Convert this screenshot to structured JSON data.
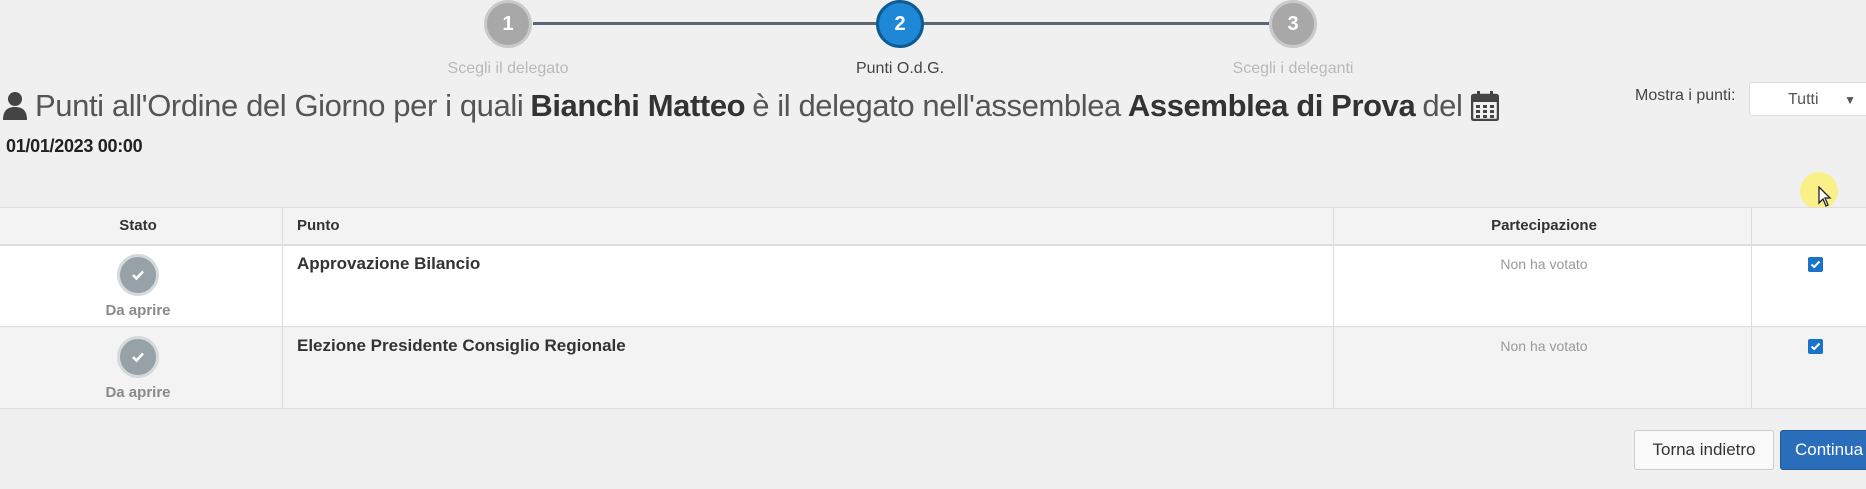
{
  "stepper": {
    "steps": [
      {
        "number": "1",
        "label": "Scegli il delegato"
      },
      {
        "number": "2",
        "label": "Punti O.d.G."
      },
      {
        "number": "3",
        "label": "Scegli i deleganti"
      }
    ],
    "active_step": 2
  },
  "header": {
    "prefix": "Punti all'Ordine del Giorno per i quali",
    "delegate_name": "Bianchi Matteo",
    "middle": "è il delegato nell'assemblea",
    "assembly_name": "Assemblea di Prova",
    "suffix": "del",
    "datetime": "01/01/2023 00:00"
  },
  "filter": {
    "label": "Mostra i punti:",
    "selected": "Tutti"
  },
  "table": {
    "columns": [
      "Stato",
      "Punto",
      "Partecipazione",
      ""
    ],
    "rows": [
      {
        "stato": "Da aprire",
        "punto": "Approvazione Bilancio",
        "partecipazione": "Non ha votato",
        "checked": true
      },
      {
        "stato": "Da aprire",
        "punto": "Elezione Presidente Consiglio Regionale",
        "partecipazione": "Non ha votato",
        "checked": true
      }
    ]
  },
  "actions": {
    "back_label": "Torna indietro",
    "next_label": "Continua"
  },
  "colors": {
    "active_step": "#1e88d6",
    "inactive_step": "#a8a8a8",
    "primary_button": "#2a6ebb",
    "checkbox": "#1a73c8"
  },
  "icons": [
    "user-icon",
    "calendar-icon",
    "check-icon",
    "chevron-down-icon"
  ]
}
